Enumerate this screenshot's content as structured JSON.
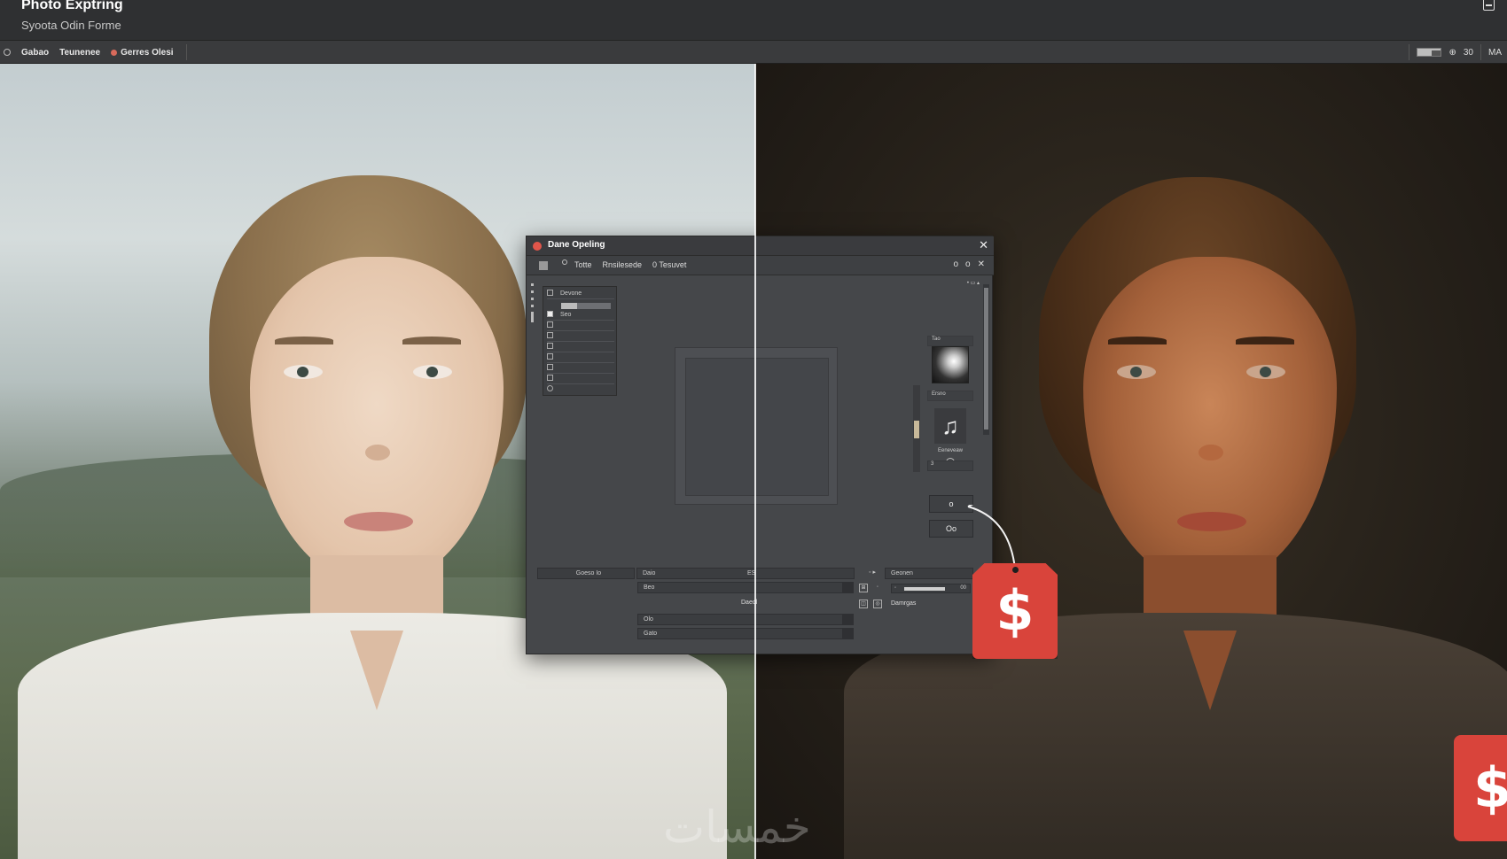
{
  "window": {
    "title": "Photo Exptring",
    "subtitle": "Syoota Odin Forme"
  },
  "toolbar": {
    "items": [
      "Gabao",
      "Teunenee"
    ],
    "tagged_item": "Gerres Olesi",
    "right_number": "30",
    "right_label": "MA"
  },
  "dialog": {
    "title": "Dane Opeling",
    "toolbar_items": [
      "Totte",
      "Rnsilesede",
      "0 Tesuvet"
    ],
    "toolbar_right": [
      "o",
      "o",
      "✕"
    ],
    "layers": [
      {
        "label": "Devone"
      },
      {
        "label": "Seo"
      }
    ],
    "thumb_top_label": "Tao",
    "thumb_mid_label": "Ersno",
    "thumb_caption": "Eeneveaw",
    "thumb_field": "3",
    "music_glyph": "♫",
    "side_buttons": [
      "o",
      "Oo"
    ],
    "bottom": {
      "left_field": "Goeso Io",
      "row1": "Daio",
      "row1_mark": "ES",
      "row2": "Beo",
      "mid_label": "Daedl",
      "row3": "Olo",
      "row4": "Gato",
      "right_top_label": "Geonen",
      "right_slider_value": "00",
      "right_bottom_label": "Damrgas"
    }
  },
  "price_tag_symbol": "$",
  "watermark": "خمسات",
  "colors": {
    "accent_red": "#d9443b",
    "chrome_dark": "#2f3032",
    "dialog_bg": "#45474a"
  }
}
